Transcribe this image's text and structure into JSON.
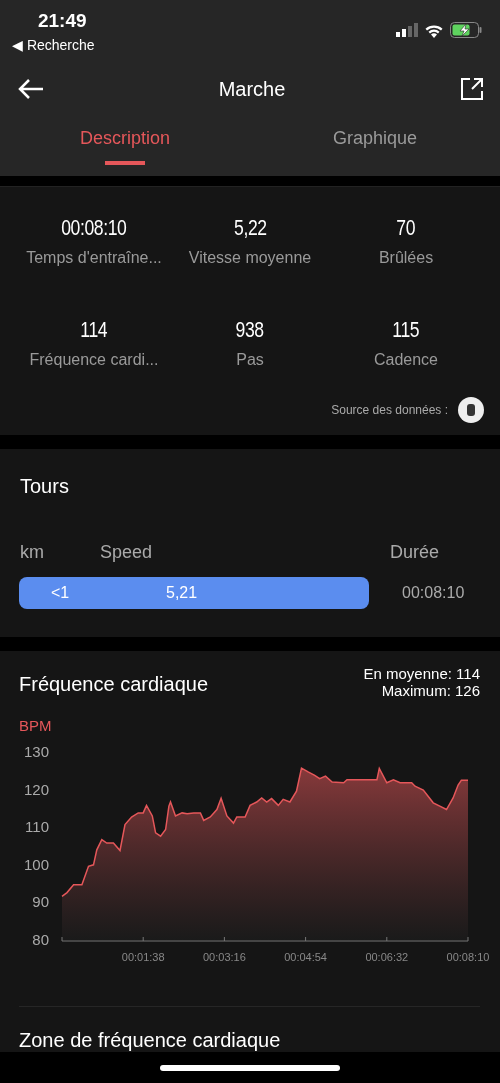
{
  "status_bar": {
    "time": "21:49",
    "back_app": "◀ Recherche"
  },
  "header": {
    "title": "Marche"
  },
  "tabs": [
    {
      "label": "Description",
      "selected": true
    },
    {
      "label": "Graphique",
      "selected": false
    }
  ],
  "stats": [
    {
      "value": "00:08:10",
      "label": "Temps d'entraîne..."
    },
    {
      "value": "5,22",
      "label": "Vitesse moyenne"
    },
    {
      "value": "70",
      "label": "Brûlées"
    },
    {
      "value": "114",
      "label": "Fréquence cardi..."
    },
    {
      "value": "938",
      "label": "Pas"
    },
    {
      "value": "115",
      "label": "Cadence"
    }
  ],
  "data_source": {
    "label": "Source des données :"
  },
  "laps": {
    "title": "Tours",
    "columns": [
      "km",
      "Speed",
      "Durée"
    ],
    "rows": [
      {
        "km": "<1",
        "speed": "5,21",
        "duration": "00:08:10"
      }
    ]
  },
  "heart_rate": {
    "title": "Fréquence cardiaque",
    "average": "En moyenne: 114",
    "maximum": "Maximum: 126",
    "chart_data": {
      "type": "area",
      "ylabel": "BPM",
      "xlim": [
        0,
        490
      ],
      "ylim": [
        80,
        130
      ],
      "yticks": [
        80,
        90,
        100,
        110,
        120,
        130
      ],
      "xticks": [
        {
          "value": 98,
          "label": "00:01:38"
        },
        {
          "value": 196,
          "label": "00:03:16"
        },
        {
          "value": 294,
          "label": "00:04:54"
        },
        {
          "value": 392,
          "label": "00:06:32"
        },
        {
          "value": 490,
          "label": "00:08:10"
        }
      ],
      "x": [
        0,
        6,
        14,
        24,
        32,
        38,
        42,
        48,
        54,
        62,
        70,
        76,
        84,
        92,
        98,
        102,
        109,
        113,
        119,
        125,
        129,
        131,
        137,
        145,
        151,
        159,
        167,
        171,
        179,
        187,
        192,
        199,
        207,
        211,
        221,
        227,
        235,
        241,
        247,
        253,
        261,
        267,
        275,
        283,
        289,
        297,
        305,
        311,
        318,
        326,
        340,
        344,
        380,
        383,
        392,
        400,
        408,
        422,
        426,
        436,
        448,
        456,
        464,
        472,
        478,
        482,
        490
      ],
      "series": [
        {
          "color": "#e5575a",
          "values": [
            91.6,
            92.6,
            94.7,
            94.7,
            99.6,
            100,
            104,
            106.7,
            105.8,
            105.8,
            103.8,
            110.7,
            112.7,
            113.8,
            113.8,
            115.8,
            113,
            108.5,
            107.6,
            109.4,
            115.6,
            116.7,
            113,
            113.8,
            113.6,
            113.8,
            113.8,
            111.8,
            112.7,
            114.7,
            117.7,
            113,
            111.1,
            112.7,
            112.7,
            115.8,
            116.7,
            117.8,
            116.7,
            117.6,
            115.8,
            117.4,
            116.7,
            119.6,
            125.7,
            124.7,
            123.8,
            122.9,
            123.6,
            122,
            121.8,
            122.6,
            122.6,
            125.6,
            121.8,
            122.6,
            121.8,
            121.8,
            120.9,
            119.9,
            116.5,
            115.6,
            114.7,
            117.8,
            121.2,
            122.5,
            122.5
          ]
        }
      ]
    }
  },
  "next_section": {
    "title": "Zone de fréquence cardiaque"
  }
}
